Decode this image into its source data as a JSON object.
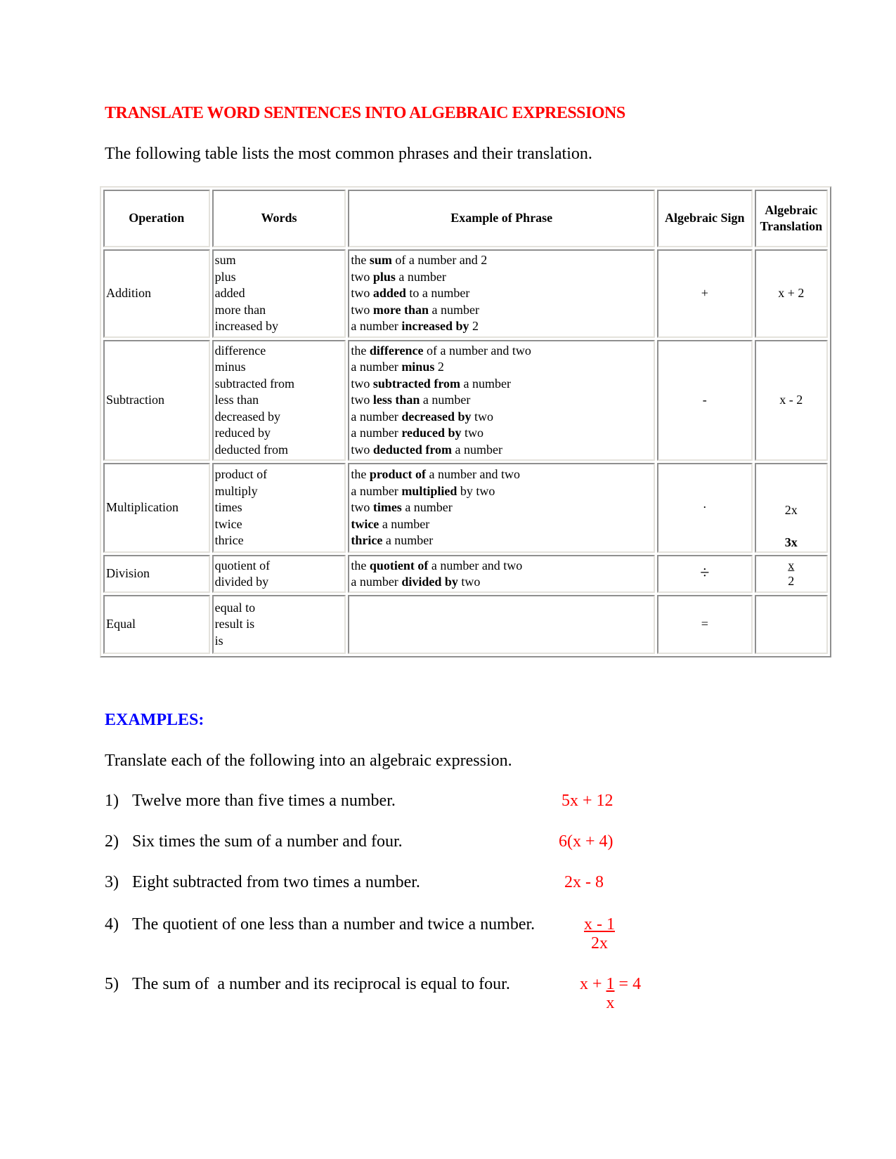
{
  "title": "TRANSLATE WORD SENTENCES INTO ALGEBRAIC EXPRESSIONS",
  "intro": "The following table lists the most common phrases and their translation.",
  "colors": {
    "title": "#ff0000",
    "examples_heading": "#0000ff",
    "answers": "#ff0000"
  },
  "table": {
    "headers": [
      "Operation",
      "Words",
      "Example of Phrase",
      "Algebraic Sign",
      "Algebraic",
      "Translation"
    ],
    "rows": [
      {
        "operation": "Addition",
        "words": [
          "sum",
          "plus",
          "added",
          "more than",
          "increased by"
        ],
        "examples": [
          {
            "pre": "the ",
            "bold": "sum",
            "post": " of a number and 2"
          },
          {
            "pre": "two ",
            "bold": "plus",
            "post": " a number"
          },
          {
            "pre": "two ",
            "bold": "added",
            "post": " to a number"
          },
          {
            "pre": "two ",
            "bold": "more than",
            "post": " a number"
          },
          {
            "pre": "a number ",
            "bold": "increased by",
            "post": " 2"
          }
        ],
        "sign": "+",
        "translation": "x + 2"
      },
      {
        "operation": "Subtraction",
        "words": [
          "difference",
          "minus",
          "subtracted from",
          "less than",
          "decreased by",
          "reduced by",
          "deducted from"
        ],
        "examples": [
          {
            "pre": "the ",
            "bold": "difference",
            "post": " of a number and two"
          },
          {
            "pre": "a number ",
            "bold": "minus",
            "post": " 2"
          },
          {
            "pre": "two ",
            "bold": "subtracted from",
            "post": " a number"
          },
          {
            "pre": "two ",
            "bold": "less than",
            "post": " a number"
          },
          {
            "pre": "a number ",
            "bold": "decreased by",
            "post": " two"
          },
          {
            "pre": "a number ",
            "bold": "reduced by",
            "post": " two"
          },
          {
            "pre": "two ",
            "bold": "deducted from",
            "post": " a number"
          }
        ],
        "sign": "-",
        "translation": "x - 2"
      },
      {
        "operation": "Multiplication",
        "words": [
          "product of",
          "multiply",
          "times",
          "twice",
          "thrice"
        ],
        "examples": [
          {
            "pre": "the ",
            "bold": "product of",
            "post": " a number and two"
          },
          {
            "pre": "a number ",
            "bold": "multiplied",
            "post": " by two"
          },
          {
            "pre": "two ",
            "bold": "times",
            "post": " a number"
          },
          {
            "pre": "",
            "bold": "twice",
            "post": " a number"
          },
          {
            "pre": "",
            "bold": "thrice",
            "post": " a number"
          }
        ],
        "sign": "·",
        "translation": "2x",
        "translation_extra": "3x"
      },
      {
        "operation": "Division",
        "words": [
          "quotient of",
          "divided by"
        ],
        "examples": [
          {
            "pre": "the ",
            "bold": "quotient of",
            "post": " a number and two"
          },
          {
            "pre": "a number ",
            "bold": "divided by",
            "post": " two"
          }
        ],
        "sign": "÷",
        "translation_num": "x",
        "translation_den": "2"
      },
      {
        "operation": "Equal",
        "words": [
          "equal to",
          "result is",
          "is"
        ],
        "examples": [],
        "sign": "=",
        "translation": ""
      }
    ]
  },
  "examples": {
    "heading": "EXAMPLES:",
    "intro": "Translate each of the following into an algebraic expression.",
    "items": [
      {
        "num": "1)",
        "text": "Twelve more than five times a number.",
        "answer": "5x + 12"
      },
      {
        "num": "2)",
        "text": "Six times the sum of a number and four.",
        "answer": "6(x + 4)"
      },
      {
        "num": "3)",
        "text": "Eight subtracted from two times a number.",
        "answer": "2x - 8"
      },
      {
        "num": "4)",
        "text": "The quotient of one less than a number and twice a number.",
        "answer_num": "x - 1",
        "answer_den": "2x"
      },
      {
        "num": "5)",
        "text": "The sum of  a number and its reciprocal is equal to four.",
        "answer_pre": "x + ",
        "answer_num": "1",
        "answer_den": "x",
        "answer_post": " = 4"
      }
    ]
  }
}
